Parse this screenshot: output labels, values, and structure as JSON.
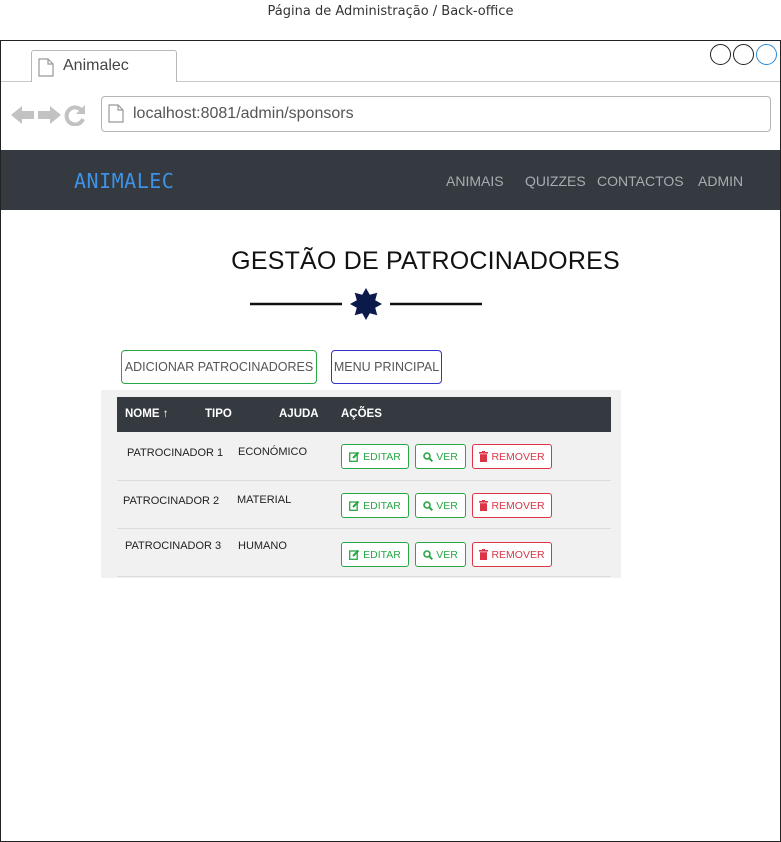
{
  "page_caption": "Página de Administração / Back-office",
  "browser": {
    "tab_title": "Animalec",
    "url": "localhost:8081/admin/sponsors"
  },
  "navbar": {
    "brand": "ANIMALEC",
    "links": [
      "ANIMAIS",
      "QUIZZES",
      "CONTACTOS",
      "ADMIN"
    ]
  },
  "main": {
    "title": "GESTÃO DE PATROCINADORES",
    "add_button": "ADICIONAR PATROCINADORES",
    "menu_button": "MENU PRINCIPAL"
  },
  "table": {
    "headers": [
      "NOME",
      "TIPO",
      "AJUDA",
      "AÇÕES"
    ],
    "sort_indicator": "↑",
    "rows": [
      {
        "name": "PATROCINADOR 1",
        "type": "ECONÓMICO"
      },
      {
        "name": "PATROCINADOR 2",
        "type": "MATERIAL"
      },
      {
        "name": "PATROCINADOR 3",
        "type": "HUMANO"
      }
    ],
    "actions": {
      "edit": "EDITAR",
      "view": "VER",
      "remove": "REMOVER"
    }
  },
  "colors": {
    "navbar_bg": "#343a40",
    "brand": "#3d92e6",
    "success": "#28a745",
    "danger": "#dc3545",
    "menu_border": "#3333cc",
    "divider_star": "#0b1a4a"
  },
  "icons": [
    "back-arrow-icon",
    "forward-arrow-icon",
    "reload-icon",
    "page-icon",
    "star-icon",
    "edit-icon",
    "search-icon",
    "trash-icon"
  ]
}
